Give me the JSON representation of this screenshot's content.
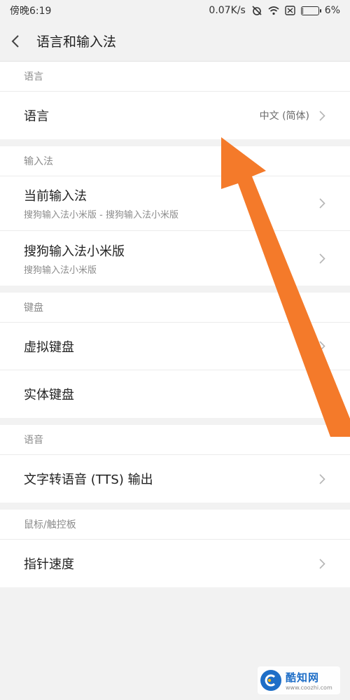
{
  "status_bar": {
    "time": "傍晚6:19",
    "speed": "0.07K/s",
    "battery_percent": "6%",
    "battery_level": 0.06
  },
  "header": {
    "title": "语言和输入法"
  },
  "sections": {
    "language": {
      "header": "语言",
      "item": {
        "label": "语言",
        "value": "中文 (简体)"
      }
    },
    "input_method": {
      "header": "输入法",
      "current": {
        "label": "当前输入法",
        "sub": "搜狗输入法小米版 - 搜狗输入法小米版"
      },
      "sogou": {
        "label": "搜狗输入法小米版",
        "sub": "搜狗输入法小米版"
      }
    },
    "keyboard": {
      "header": "键盘",
      "virtual": {
        "label": "虚拟键盘"
      },
      "physical": {
        "label": "实体键盘"
      }
    },
    "speech": {
      "header": "语音",
      "tts": {
        "label": "文字转语音 (TTS) 输出"
      }
    },
    "mouse": {
      "header": "鼠标/触控板",
      "pointer": {
        "label": "指针速度"
      }
    }
  },
  "watermark": {
    "name": "酷知网",
    "url": "www.coozhi.com"
  },
  "colors": {
    "arrow": "#f47a2a",
    "watermark_blue": "#1e6ec7"
  }
}
